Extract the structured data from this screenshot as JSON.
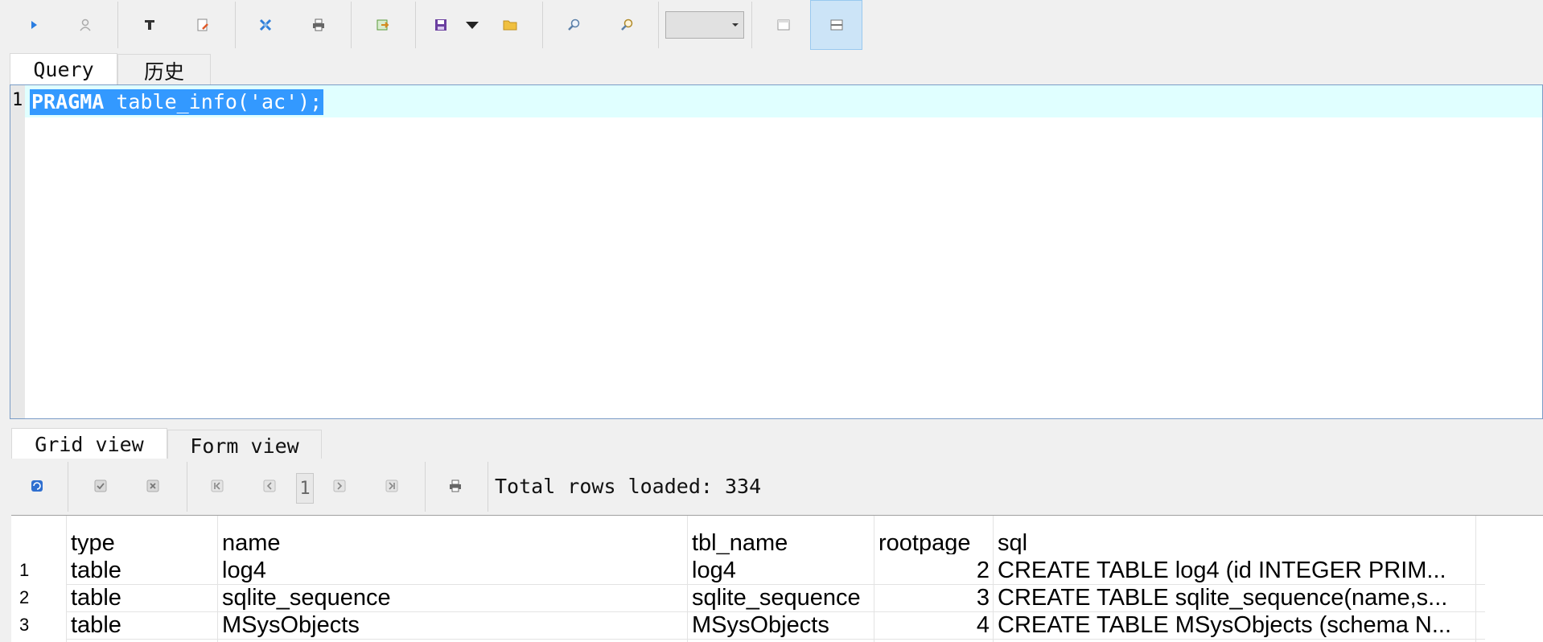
{
  "toolbar": {
    "buttons": [
      "execute",
      "explain",
      "format-sql",
      "clear-editor",
      "tools",
      "print",
      "export",
      "save",
      "open",
      "find",
      "replace",
      "layout-horizontal",
      "layout-vertical"
    ],
    "combo_value": ""
  },
  "query_tabs": [
    {
      "label": "Query",
      "selected": true
    },
    {
      "label": "历史",
      "selected": false
    }
  ],
  "editor": {
    "line_number": "1",
    "keyword": "PRAGMA",
    "rest": " table_info('ac');"
  },
  "result_tabs": [
    {
      "label": "Grid view",
      "selected": true
    },
    {
      "label": "Form view",
      "selected": false
    }
  ],
  "results": {
    "page": "1",
    "status": "Total rows loaded: 334"
  },
  "grid": {
    "columns": [
      "type",
      "name",
      "tbl_name",
      "rootpage",
      "sql"
    ],
    "rows": [
      {
        "num": "1",
        "type": "table",
        "name": "log4",
        "tbl_name": "log4",
        "rootpage": "2",
        "sql": "CREATE TABLE log4 (id INTEGER PRIM..."
      },
      {
        "num": "2",
        "type": "table",
        "name": "sqlite_sequence",
        "tbl_name": "sqlite_sequence",
        "rootpage": "3",
        "sql": "CREATE TABLE sqlite_sequence(name,s..."
      },
      {
        "num": "3",
        "type": "table",
        "name": "MSysObjects",
        "tbl_name": "MSysObjects",
        "rootpage": "4",
        "sql": "CREATE TABLE MSysObjects (schema N..."
      }
    ]
  },
  "colors": {
    "selection": "#3399ff",
    "current_line": "#e0ffff",
    "active_button": "#cce4f7"
  }
}
